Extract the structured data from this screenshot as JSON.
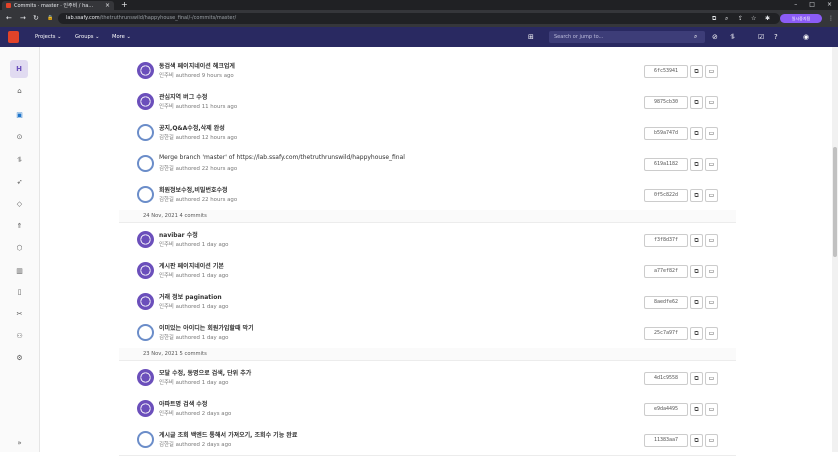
{
  "browser": {
    "tab_title": "Commits · master · 인주비 / ha…",
    "tab_close": "×",
    "new_tab": "+",
    "url_domain": "lab.ssafy.com",
    "url_path": "/thetruthrunswild/happyhouse_final/-/commits/master/",
    "profile_label": "일시중지됨",
    "window_controls": [
      "–",
      "□",
      "×"
    ]
  },
  "gitlab_nav": {
    "projects": "Projects ⌄",
    "groups": "Groups ⌄",
    "more": "More ⌄",
    "search_placeholder": "Search or jump to..."
  },
  "sidebar": {
    "project_initial": "H",
    "collapse": "»"
  },
  "commit_list": [
    {
      "type": "commit",
      "message": "동검색 페이지네이션 헤크업게",
      "meta": "인주비 authored 9 hours ago",
      "sha": "6fc53941",
      "avatar": "a"
    },
    {
      "type": "commit",
      "message": "관심지역 버그 수정",
      "meta": "인주비 authored 11 hours ago",
      "sha": "9875cb30",
      "avatar": "a"
    },
    {
      "type": "commit",
      "message": "공지,Q&A수정,삭제 완성",
      "meta": "김한길 authored 12 hours ago",
      "sha": "b59a747d",
      "avatar": "b"
    },
    {
      "type": "commit",
      "message": "Merge branch 'master' of https://lab.ssafy.com/thetruthrunswild/happyhouse_final",
      "meta": "김한길 authored 22 hours ago",
      "sha": "619a1182",
      "avatar": "b",
      "plain": true
    },
    {
      "type": "commit",
      "message": "회원정보수정,비밀번호수정",
      "meta": "김한길 authored 22 hours ago",
      "sha": "0f5c822d",
      "avatar": "b"
    },
    {
      "type": "date",
      "label": "24 Nov, 2021 4 commits"
    },
    {
      "type": "commit",
      "message": "navibar 수정",
      "meta": "인주비 authored 1 day ago",
      "sha": "f3f8d37f",
      "avatar": "a"
    },
    {
      "type": "commit",
      "message": "게시판 페이지네이션 기본",
      "meta": "인주비 authored 1 day ago",
      "sha": "a77ef82f",
      "avatar": "a"
    },
    {
      "type": "commit",
      "message": "거래 정보 pagination",
      "meta": "인주비 authored 1 day ago",
      "sha": "8aedfe62",
      "avatar": "a"
    },
    {
      "type": "commit",
      "message": "이미있는 아이디는 회원가입할때 막기",
      "meta": "김한길 authored 1 day ago",
      "sha": "25c7a97f",
      "avatar": "b"
    },
    {
      "type": "date",
      "label": "23 Nov, 2021 5 commits"
    },
    {
      "type": "commit",
      "message": "모달 수정, 동명으로 검색, 단위 추가",
      "meta": "인주비 authored 1 day ago",
      "sha": "4d1c9558",
      "avatar": "a"
    },
    {
      "type": "commit",
      "message": "아파트명 검색 수정",
      "meta": "인주비 authored 2 days ago",
      "sha": "e9da4495",
      "avatar": "a"
    },
    {
      "type": "commit",
      "message": "게시글 조회 백엔드 통해서 가져오기, 조회수 기능 완료",
      "meta": "김한길 authored 2 days ago",
      "sha": "11383aa7",
      "avatar": "b"
    }
  ],
  "icons": {
    "copy": "⧉",
    "browse": "▭"
  }
}
